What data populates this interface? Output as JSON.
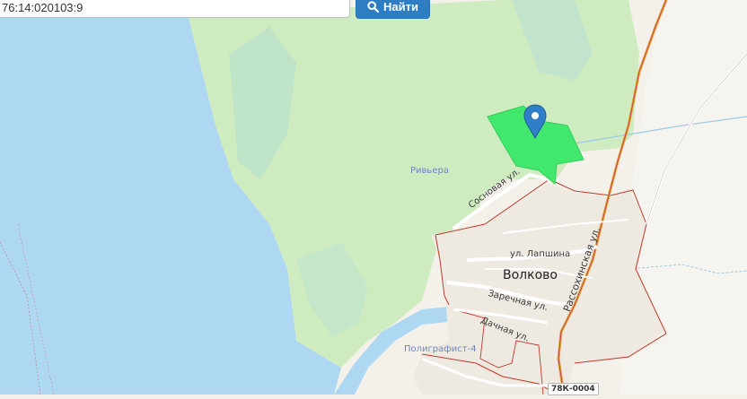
{
  "search": {
    "value": "76:14:020103:9",
    "button_label": "Найти",
    "button_icon": "search-icon"
  },
  "map": {
    "place_name": "Волково",
    "poi_riviera": "Ривьера",
    "poi_poligrafist": "Полиграфист-4",
    "streets": {
      "sosnovaya": "Сосновая ул.",
      "lapshina": "ул. Лапшина",
      "zarechnaya": "Заречная ул.",
      "dachnaya": "Дачная ул.",
      "rassokhinskaya": "Рассохинская ул."
    },
    "road_badge": "78К-0004",
    "marker_icon": "map-pin-icon",
    "colors": {
      "water": "#aed8f2",
      "forest": "#cdecc0",
      "parcel": "#42e86e",
      "boundary": "#c0392b",
      "marker": "#2e7fc8"
    }
  }
}
